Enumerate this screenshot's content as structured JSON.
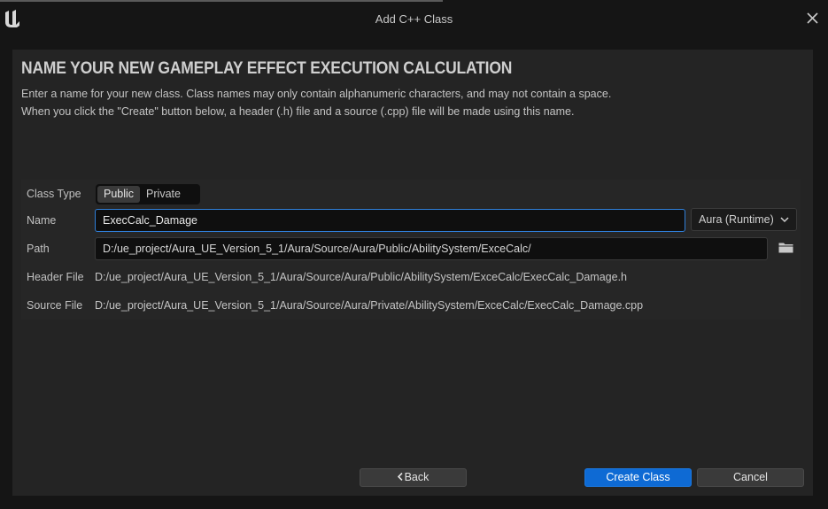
{
  "window": {
    "title": "Add C++ Class",
    "logo_icon": "unreal-engine-logo",
    "close_icon": "close-icon"
  },
  "header": {
    "heading": "NAME YOUR NEW GAMEPLAY EFFECT EXECUTION CALCULATION",
    "description_line1": "Enter a name for your new class. Class names may only contain alphanumeric characters, and may not contain a space.",
    "description_line2": "When you click the \"Create\" button below, a header (.h) file and a source (.cpp) file will be made using this name."
  },
  "form": {
    "class_type": {
      "label": "Class Type",
      "options": [
        "Public",
        "Private"
      ],
      "selected": "Public"
    },
    "name": {
      "label": "Name",
      "value": "ExecCalc_Damage"
    },
    "module": {
      "selected": "Aura (Runtime)",
      "icon": "chevron-down-icon"
    },
    "path": {
      "label": "Path",
      "value": "D:/ue_project/Aura_UE_Version_5_1/Aura/Source/Aura/Public/AbilitySystem/ExceCalc/",
      "browse_icon": "folder-icon"
    },
    "header_file": {
      "label": "Header File",
      "value": "D:/ue_project/Aura_UE_Version_5_1/Aura/Source/Aura/Public/AbilitySystem/ExceCalc/ExecCalc_Damage.h"
    },
    "source_file": {
      "label": "Source File",
      "value": "D:/ue_project/Aura_UE_Version_5_1/Aura/Source/Aura/Private/AbilitySystem/ExceCalc/ExecCalc_Damage.cpp"
    }
  },
  "buttons": {
    "back": "Back",
    "create": "Create Class",
    "cancel": "Cancel"
  },
  "colors": {
    "accent": "#0e6ad4",
    "focus_border": "#2f7fd9",
    "panel": "#242424",
    "background": "#151515"
  }
}
